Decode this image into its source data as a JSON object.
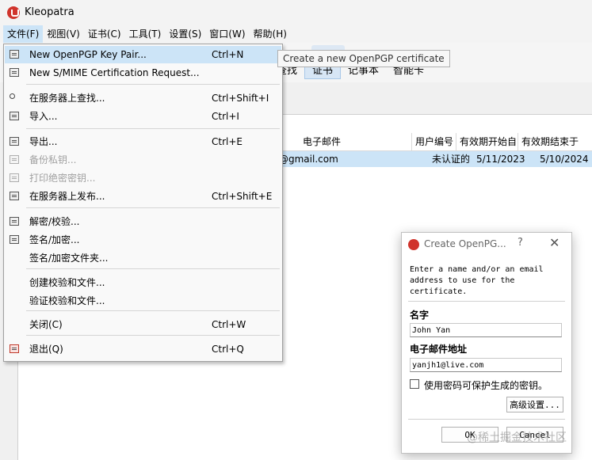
{
  "window": {
    "title": "Kleopatra"
  },
  "menubar": [
    "文件(F)",
    "视图(V)",
    "证书(C)",
    "工具(T)",
    "设置(S)",
    "窗口(W)",
    "帮助(H)"
  ],
  "toolbar_tabs": [
    "查找",
    "证书",
    "记事本",
    "智能卡"
  ],
  "columns": [
    "电子邮件",
    "用户编号",
    "有效期开始自",
    "有效期结束于"
  ],
  "cert_row": {
    "email": "@gmail.com",
    "user_id": "未认证的",
    "valid_from": "5/11/2023",
    "valid_until": "5/10/2024"
  },
  "file_menu": [
    {
      "label": "New OpenPGP Key Pair...",
      "shortcut": "Ctrl+N",
      "icon": "keypair-icon",
      "highlighted": true,
      "disabled": false
    },
    {
      "label": "New S/MIME Certification Request...",
      "shortcut": "",
      "icon": "keypair-icon",
      "highlighted": false,
      "disabled": false
    },
    {
      "label": "在服务器上查找...",
      "shortcut": "Ctrl+Shift+I",
      "icon": "search-icon",
      "highlighted": false,
      "disabled": false
    },
    {
      "label": "导入...",
      "shortcut": "Ctrl+I",
      "icon": "import-icon",
      "highlighted": false,
      "disabled": false
    },
    {
      "label": "导出...",
      "shortcut": "Ctrl+E",
      "icon": "export-icon",
      "highlighted": false,
      "disabled": false
    },
    {
      "label": "备份私钥...",
      "shortcut": "",
      "icon": "backup-icon",
      "highlighted": false,
      "disabled": true
    },
    {
      "label": "打印绝密密钥...",
      "shortcut": "",
      "icon": "printer-icon",
      "highlighted": false,
      "disabled": true
    },
    {
      "label": "在服务器上发布...",
      "shortcut": "Ctrl+Shift+E",
      "icon": "publish-icon",
      "highlighted": false,
      "disabled": false
    },
    {
      "label": "解密/校验...",
      "shortcut": "",
      "icon": "decrypt-icon",
      "highlighted": false,
      "disabled": false
    },
    {
      "label": "签名/加密...",
      "shortcut": "",
      "icon": "sign-icon",
      "highlighted": false,
      "disabled": false
    },
    {
      "label": "签名/加密文件夹...",
      "shortcut": "",
      "icon": "",
      "highlighted": false,
      "disabled": false
    },
    {
      "label": "创建校验和文件...",
      "shortcut": "",
      "icon": "",
      "highlighted": false,
      "disabled": false
    },
    {
      "label": "验证校验和文件...",
      "shortcut": "",
      "icon": "",
      "highlighted": false,
      "disabled": false
    },
    {
      "label": "关闭(C)",
      "shortcut": "Ctrl+W",
      "icon": "",
      "highlighted": false,
      "disabled": false
    },
    {
      "label": "退出(Q)",
      "shortcut": "Ctrl+Q",
      "icon": "quit-icon",
      "highlighted": false,
      "disabled": false
    }
  ],
  "tooltip": "Create a new OpenPGP certificate",
  "dialog": {
    "title": "Create OpenPG...",
    "help": "?",
    "close": "✕",
    "intro": "Enter a name and/or an email address to use for the certificate.",
    "name_label": "名字",
    "name_value": "John Yan",
    "email_label": "电子邮件地址",
    "email_value": "yanjh1@live.com",
    "checkbox_label": "使用密码可保护生成的密钥。",
    "advanced_button": "高级设置...",
    "ok_button": "OK",
    "cancel_button": "Cancel"
  },
  "watermark": "@稀土掘金技术社区"
}
